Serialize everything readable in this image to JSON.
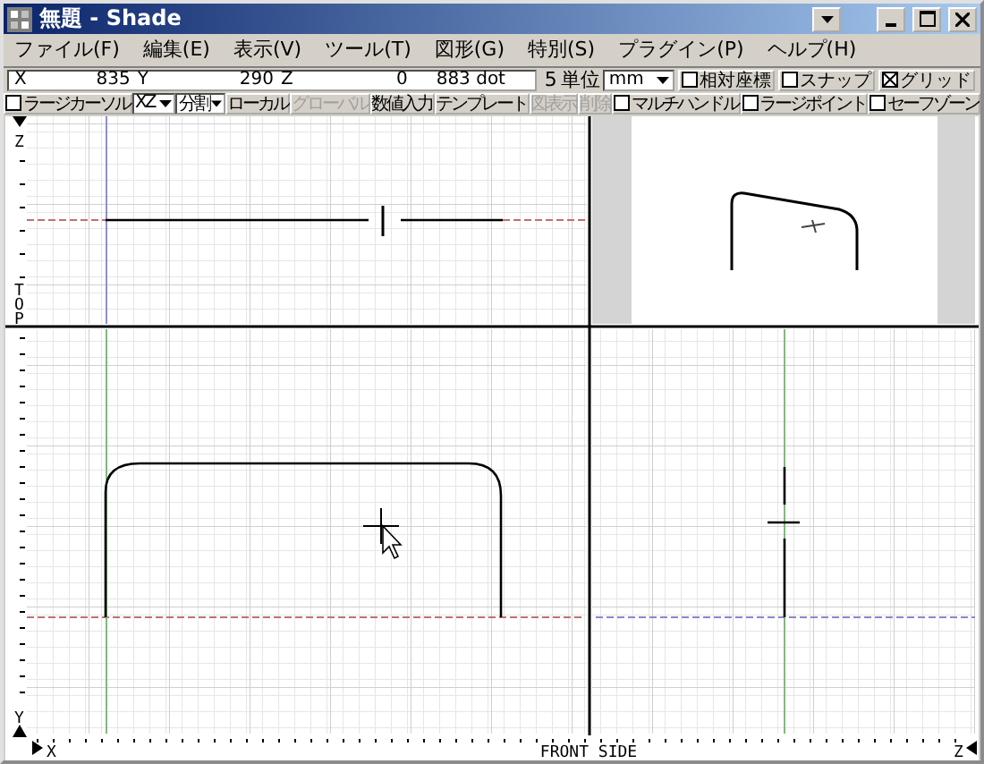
{
  "window": {
    "title": "無題 - Shade"
  },
  "menu": [
    {
      "label": "ファイル(F)"
    },
    {
      "label": "編集(E)"
    },
    {
      "label": "表示(V)"
    },
    {
      "label": "ツール(T)"
    },
    {
      "label": "図形(G)"
    },
    {
      "label": "特別(S)"
    },
    {
      "label": "プラグイン(P)"
    },
    {
      "label": "ヘルプ(H)"
    }
  ],
  "coords": {
    "fields": [
      {
        "label": "X",
        "value": "835"
      },
      {
        "label": "Y",
        "value": "290"
      },
      {
        "label": "Z",
        "value": "0"
      }
    ],
    "size": "883 dot",
    "grid_step": "5",
    "unit_label": "単位",
    "unit": "mm",
    "options": [
      {
        "label": "相対座標",
        "checked": false
      },
      {
        "label": "スナップ",
        "checked": false
      },
      {
        "label": "グリッド",
        "checked": true
      }
    ]
  },
  "toolbar": [
    {
      "kind": "checkbox",
      "label": "ラージカーソル",
      "checked": false
    },
    {
      "kind": "dropdown",
      "label": "XZ"
    },
    {
      "kind": "dropdown",
      "label": "分割"
    },
    {
      "kind": "button",
      "label": "ローカル",
      "disabled": false
    },
    {
      "kind": "button",
      "label": "グローバル",
      "disabled": true
    },
    {
      "kind": "button",
      "label": "数値入力",
      "disabled": false
    },
    {
      "kind": "button",
      "label": "テンプレート",
      "disabled": false
    },
    {
      "kind": "button",
      "label": "図表示",
      "disabled": true
    },
    {
      "kind": "button",
      "label": "削除",
      "disabled": true
    },
    {
      "kind": "checkbox",
      "label": "マルチハンドル",
      "checked": false
    },
    {
      "kind": "checkbox",
      "label": "ラージポイント",
      "checked": false
    },
    {
      "kind": "checkbox",
      "label": "セーフゾーン",
      "checked": false
    }
  ],
  "views": {
    "top_axis": "Z",
    "top_name": "TOP",
    "front_axis_y": "Y",
    "front_axis_x": "X",
    "front_name": "FRONT SIDE",
    "side_axis": "Z"
  }
}
